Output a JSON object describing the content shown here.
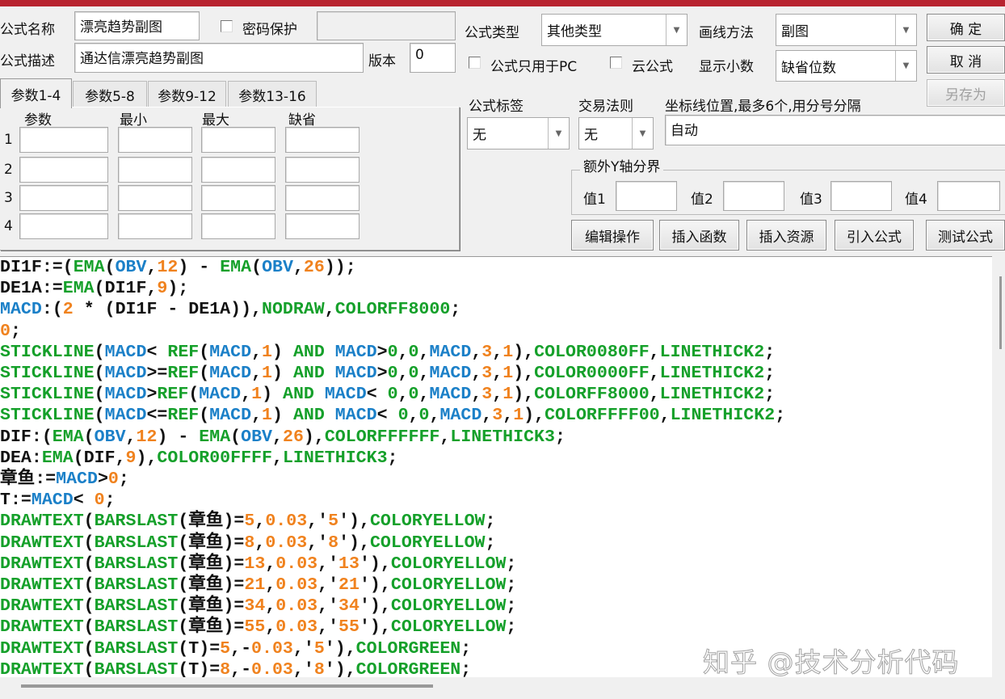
{
  "header": {
    "name_label": "公式名称",
    "name_value": "漂亮趋势副图",
    "password_label": "密码保护",
    "password_checked": false,
    "desc_label": "公式描述",
    "desc_value": "通达信漂亮趋势副图",
    "version_label": "版本",
    "version_value": "0",
    "type_label": "公式类型",
    "type_value": "其他类型",
    "draw_label": "画线方法",
    "draw_value": "副图",
    "pc_only_label": "公式只用于PC",
    "cloud_label": "云公式",
    "decimals_label": "显示小数",
    "decimals_value": "缺省位数",
    "tag_label": "公式标签",
    "tag_value": "无",
    "rule_label": "交易法则",
    "rule_value": "无",
    "axis_label": "坐标线位置,最多6个,用分号分隔",
    "axis_value": "自动",
    "yaxis_group": "额外Y轴分界",
    "y_values": [
      "值1",
      "值2",
      "值3",
      "值4"
    ]
  },
  "buttons": {
    "ok": "确 定",
    "cancel": "取 消",
    "save_as": "另存为",
    "edit": "编辑操作",
    "insert_func": "插入函数",
    "insert_res": "插入资源",
    "import": "引入公式",
    "test": "测试公式"
  },
  "tabs": [
    "参数1-4",
    "参数5-8",
    "参数9-12",
    "参数13-16"
  ],
  "param_headers": [
    "参数",
    "最小",
    "最大",
    "缺省"
  ],
  "param_rows": [
    "1",
    "2",
    "3",
    "4"
  ],
  "watermark": "知乎 @技术分析代码",
  "code_lines": [
    [
      [
        "p",
        "DI1F:=("
      ],
      [
        "k",
        "EMA"
      ],
      [
        "p",
        "("
      ],
      [
        "v",
        "OBV"
      ],
      [
        "p",
        ","
      ],
      [
        "n",
        "12"
      ],
      [
        "p",
        ") - "
      ],
      [
        "k",
        "EMA"
      ],
      [
        "p",
        "("
      ],
      [
        "v",
        "OBV"
      ],
      [
        "p",
        ","
      ],
      [
        "n",
        "26"
      ],
      [
        "p",
        "));"
      ]
    ],
    [
      [
        "p",
        "DE1A:="
      ],
      [
        "k",
        "EMA"
      ],
      [
        "p",
        "(DI1F,"
      ],
      [
        "n",
        "9"
      ],
      [
        "p",
        ");"
      ]
    ],
    [
      [
        "v",
        "MACD"
      ],
      [
        "p",
        ":("
      ],
      [
        "n",
        "2"
      ],
      [
        "p",
        " * (DI1F - DE1A)),"
      ],
      [
        "k",
        "NODRAW"
      ],
      [
        "p",
        ","
      ],
      [
        "k",
        "COLORFF8000"
      ],
      [
        "p",
        ";"
      ]
    ],
    [
      [
        "n",
        "0"
      ],
      [
        "p",
        ";"
      ]
    ],
    [
      [
        "k",
        "STICKLINE"
      ],
      [
        "p",
        "("
      ],
      [
        "v",
        "MACD"
      ],
      [
        "p",
        "< "
      ],
      [
        "k",
        "REF"
      ],
      [
        "p",
        "("
      ],
      [
        "v",
        "MACD"
      ],
      [
        "p",
        ","
      ],
      [
        "n",
        "1"
      ],
      [
        "p",
        ") "
      ],
      [
        "k",
        "AND"
      ],
      [
        "p",
        " "
      ],
      [
        "v",
        "MACD"
      ],
      [
        "p",
        ">"
      ],
      [
        "k",
        "0"
      ],
      [
        "p",
        ","
      ],
      [
        "k",
        "0"
      ],
      [
        "p",
        ","
      ],
      [
        "v",
        "MACD"
      ],
      [
        "p",
        ","
      ],
      [
        "n",
        "3"
      ],
      [
        "p",
        ","
      ],
      [
        "n",
        "1"
      ],
      [
        "p",
        "),"
      ],
      [
        "k",
        "COLOR0080FF"
      ],
      [
        "p",
        ","
      ],
      [
        "k",
        "LINETHICK2"
      ],
      [
        "p",
        ";"
      ]
    ],
    [
      [
        "k",
        "STICKLINE"
      ],
      [
        "p",
        "("
      ],
      [
        "v",
        "MACD"
      ],
      [
        "p",
        ">="
      ],
      [
        "k",
        "REF"
      ],
      [
        "p",
        "("
      ],
      [
        "v",
        "MACD"
      ],
      [
        "p",
        ","
      ],
      [
        "n",
        "1"
      ],
      [
        "p",
        ") "
      ],
      [
        "k",
        "AND"
      ],
      [
        "p",
        " "
      ],
      [
        "v",
        "MACD"
      ],
      [
        "p",
        ">"
      ],
      [
        "k",
        "0"
      ],
      [
        "p",
        ","
      ],
      [
        "k",
        "0"
      ],
      [
        "p",
        ","
      ],
      [
        "v",
        "MACD"
      ],
      [
        "p",
        ","
      ],
      [
        "n",
        "3"
      ],
      [
        "p",
        ","
      ],
      [
        "n",
        "1"
      ],
      [
        "p",
        "),"
      ],
      [
        "k",
        "COLOR0000FF"
      ],
      [
        "p",
        ","
      ],
      [
        "k",
        "LINETHICK2"
      ],
      [
        "p",
        ";"
      ]
    ],
    [
      [
        "k",
        "STICKLINE"
      ],
      [
        "p",
        "("
      ],
      [
        "v",
        "MACD"
      ],
      [
        "p",
        ">"
      ],
      [
        "k",
        "REF"
      ],
      [
        "p",
        "("
      ],
      [
        "v",
        "MACD"
      ],
      [
        "p",
        ","
      ],
      [
        "n",
        "1"
      ],
      [
        "p",
        ") "
      ],
      [
        "k",
        "AND"
      ],
      [
        "p",
        " "
      ],
      [
        "v",
        "MACD"
      ],
      [
        "p",
        "< "
      ],
      [
        "k",
        "0"
      ],
      [
        "p",
        ","
      ],
      [
        "k",
        "0"
      ],
      [
        "p",
        ","
      ],
      [
        "v",
        "MACD"
      ],
      [
        "p",
        ","
      ],
      [
        "n",
        "3"
      ],
      [
        "p",
        ","
      ],
      [
        "n",
        "1"
      ],
      [
        "p",
        "),"
      ],
      [
        "k",
        "COLORFF8000"
      ],
      [
        "p",
        ","
      ],
      [
        "k",
        "LINETHICK2"
      ],
      [
        "p",
        ";"
      ]
    ],
    [
      [
        "k",
        "STICKLINE"
      ],
      [
        "p",
        "("
      ],
      [
        "v",
        "MACD"
      ],
      [
        "p",
        "<="
      ],
      [
        "k",
        "REF"
      ],
      [
        "p",
        "("
      ],
      [
        "v",
        "MACD"
      ],
      [
        "p",
        ","
      ],
      [
        "n",
        "1"
      ],
      [
        "p",
        ") "
      ],
      [
        "k",
        "AND"
      ],
      [
        "p",
        " "
      ],
      [
        "v",
        "MACD"
      ],
      [
        "p",
        "< "
      ],
      [
        "k",
        "0"
      ],
      [
        "p",
        ","
      ],
      [
        "k",
        "0"
      ],
      [
        "p",
        ","
      ],
      [
        "v",
        "MACD"
      ],
      [
        "p",
        ","
      ],
      [
        "n",
        "3"
      ],
      [
        "p",
        ","
      ],
      [
        "n",
        "1"
      ],
      [
        "p",
        "),"
      ],
      [
        "k",
        "COLORFFFF00"
      ],
      [
        "p",
        ","
      ],
      [
        "k",
        "LINETHICK2"
      ],
      [
        "p",
        ";"
      ]
    ],
    [
      [
        "p",
        "DIF:("
      ],
      [
        "k",
        "EMA"
      ],
      [
        "p",
        "("
      ],
      [
        "v",
        "OBV"
      ],
      [
        "p",
        ","
      ],
      [
        "n",
        "12"
      ],
      [
        "p",
        ") - "
      ],
      [
        "k",
        "EMA"
      ],
      [
        "p",
        "("
      ],
      [
        "v",
        "OBV"
      ],
      [
        "p",
        ","
      ],
      [
        "n",
        "26"
      ],
      [
        "p",
        "),"
      ],
      [
        "k",
        "COLORFFFFFF"
      ],
      [
        "p",
        ","
      ],
      [
        "k",
        "LINETHICK3"
      ],
      [
        "p",
        ";"
      ]
    ],
    [
      [
        "p",
        "DEA:"
      ],
      [
        "k",
        "EMA"
      ],
      [
        "p",
        "(DIF,"
      ],
      [
        "n",
        "9"
      ],
      [
        "p",
        "),"
      ],
      [
        "k",
        "COLOR00FFFF"
      ],
      [
        "p",
        ","
      ],
      [
        "k",
        "LINETHICK3"
      ],
      [
        "p",
        ";"
      ]
    ],
    [
      [
        "p",
        "章鱼:="
      ],
      [
        "v",
        "MACD"
      ],
      [
        "p",
        ">"
      ],
      [
        "n",
        "0"
      ],
      [
        "p",
        ";"
      ]
    ],
    [
      [
        "p",
        "T:="
      ],
      [
        "v",
        "MACD"
      ],
      [
        "p",
        "< "
      ],
      [
        "n",
        "0"
      ],
      [
        "p",
        ";"
      ]
    ],
    [
      [
        "k",
        "DRAWTEXT"
      ],
      [
        "p",
        "("
      ],
      [
        "k",
        "BARSLAST"
      ],
      [
        "p",
        "(章鱼)="
      ],
      [
        "n",
        "5"
      ],
      [
        "p",
        ","
      ],
      [
        "n",
        "0.03"
      ],
      [
        "p",
        ",'"
      ],
      [
        "n",
        "5"
      ],
      [
        "p",
        "'),"
      ],
      [
        "k",
        "COLORYELLOW"
      ],
      [
        "p",
        ";"
      ]
    ],
    [
      [
        "k",
        "DRAWTEXT"
      ],
      [
        "p",
        "("
      ],
      [
        "k",
        "BARSLAST"
      ],
      [
        "p",
        "(章鱼)="
      ],
      [
        "n",
        "8"
      ],
      [
        "p",
        ","
      ],
      [
        "n",
        "0.03"
      ],
      [
        "p",
        ",'"
      ],
      [
        "n",
        "8"
      ],
      [
        "p",
        "'),"
      ],
      [
        "k",
        "COLORYELLOW"
      ],
      [
        "p",
        ";"
      ]
    ],
    [
      [
        "k",
        "DRAWTEXT"
      ],
      [
        "p",
        "("
      ],
      [
        "k",
        "BARSLAST"
      ],
      [
        "p",
        "(章鱼)="
      ],
      [
        "n",
        "13"
      ],
      [
        "p",
        ","
      ],
      [
        "n",
        "0.03"
      ],
      [
        "p",
        ",'"
      ],
      [
        "n",
        "13"
      ],
      [
        "p",
        "'),"
      ],
      [
        "k",
        "COLORYELLOW"
      ],
      [
        "p",
        ";"
      ]
    ],
    [
      [
        "k",
        "DRAWTEXT"
      ],
      [
        "p",
        "("
      ],
      [
        "k",
        "BARSLAST"
      ],
      [
        "p",
        "(章鱼)="
      ],
      [
        "n",
        "21"
      ],
      [
        "p",
        ","
      ],
      [
        "n",
        "0.03"
      ],
      [
        "p",
        ",'"
      ],
      [
        "n",
        "21"
      ],
      [
        "p",
        "'),"
      ],
      [
        "k",
        "COLORYELLOW"
      ],
      [
        "p",
        ";"
      ]
    ],
    [
      [
        "k",
        "DRAWTEXT"
      ],
      [
        "p",
        "("
      ],
      [
        "k",
        "BARSLAST"
      ],
      [
        "p",
        "(章鱼)="
      ],
      [
        "n",
        "34"
      ],
      [
        "p",
        ","
      ],
      [
        "n",
        "0.03"
      ],
      [
        "p",
        ",'"
      ],
      [
        "n",
        "34"
      ],
      [
        "p",
        "'),"
      ],
      [
        "k",
        "COLORYELLOW"
      ],
      [
        "p",
        ";"
      ]
    ],
    [
      [
        "k",
        "DRAWTEXT"
      ],
      [
        "p",
        "("
      ],
      [
        "k",
        "BARSLAST"
      ],
      [
        "p",
        "(章鱼)="
      ],
      [
        "n",
        "55"
      ],
      [
        "p",
        ","
      ],
      [
        "n",
        "0.03"
      ],
      [
        "p",
        ",'"
      ],
      [
        "n",
        "55"
      ],
      [
        "p",
        "'),"
      ],
      [
        "k",
        "COLORYELLOW"
      ],
      [
        "p",
        ";"
      ]
    ],
    [
      [
        "k",
        "DRAWTEXT"
      ],
      [
        "p",
        "("
      ],
      [
        "k",
        "BARSLAST"
      ],
      [
        "p",
        "(T)="
      ],
      [
        "n",
        "5"
      ],
      [
        "p",
        ",-"
      ],
      [
        "n",
        "0.03"
      ],
      [
        "p",
        ",'"
      ],
      [
        "n",
        "5"
      ],
      [
        "p",
        "'),"
      ],
      [
        "k",
        "COLORGREEN"
      ],
      [
        "p",
        ";"
      ]
    ],
    [
      [
        "k",
        "DRAWTEXT"
      ],
      [
        "p",
        "("
      ],
      [
        "k",
        "BARSLAST"
      ],
      [
        "p",
        "(T)="
      ],
      [
        "n",
        "8"
      ],
      [
        "p",
        ",-"
      ],
      [
        "n",
        "0.03"
      ],
      [
        "p",
        ",'"
      ],
      [
        "n",
        "8"
      ],
      [
        "p",
        "'),"
      ],
      [
        "k",
        "COLORGREEN"
      ],
      [
        "p",
        ";"
      ]
    ]
  ]
}
